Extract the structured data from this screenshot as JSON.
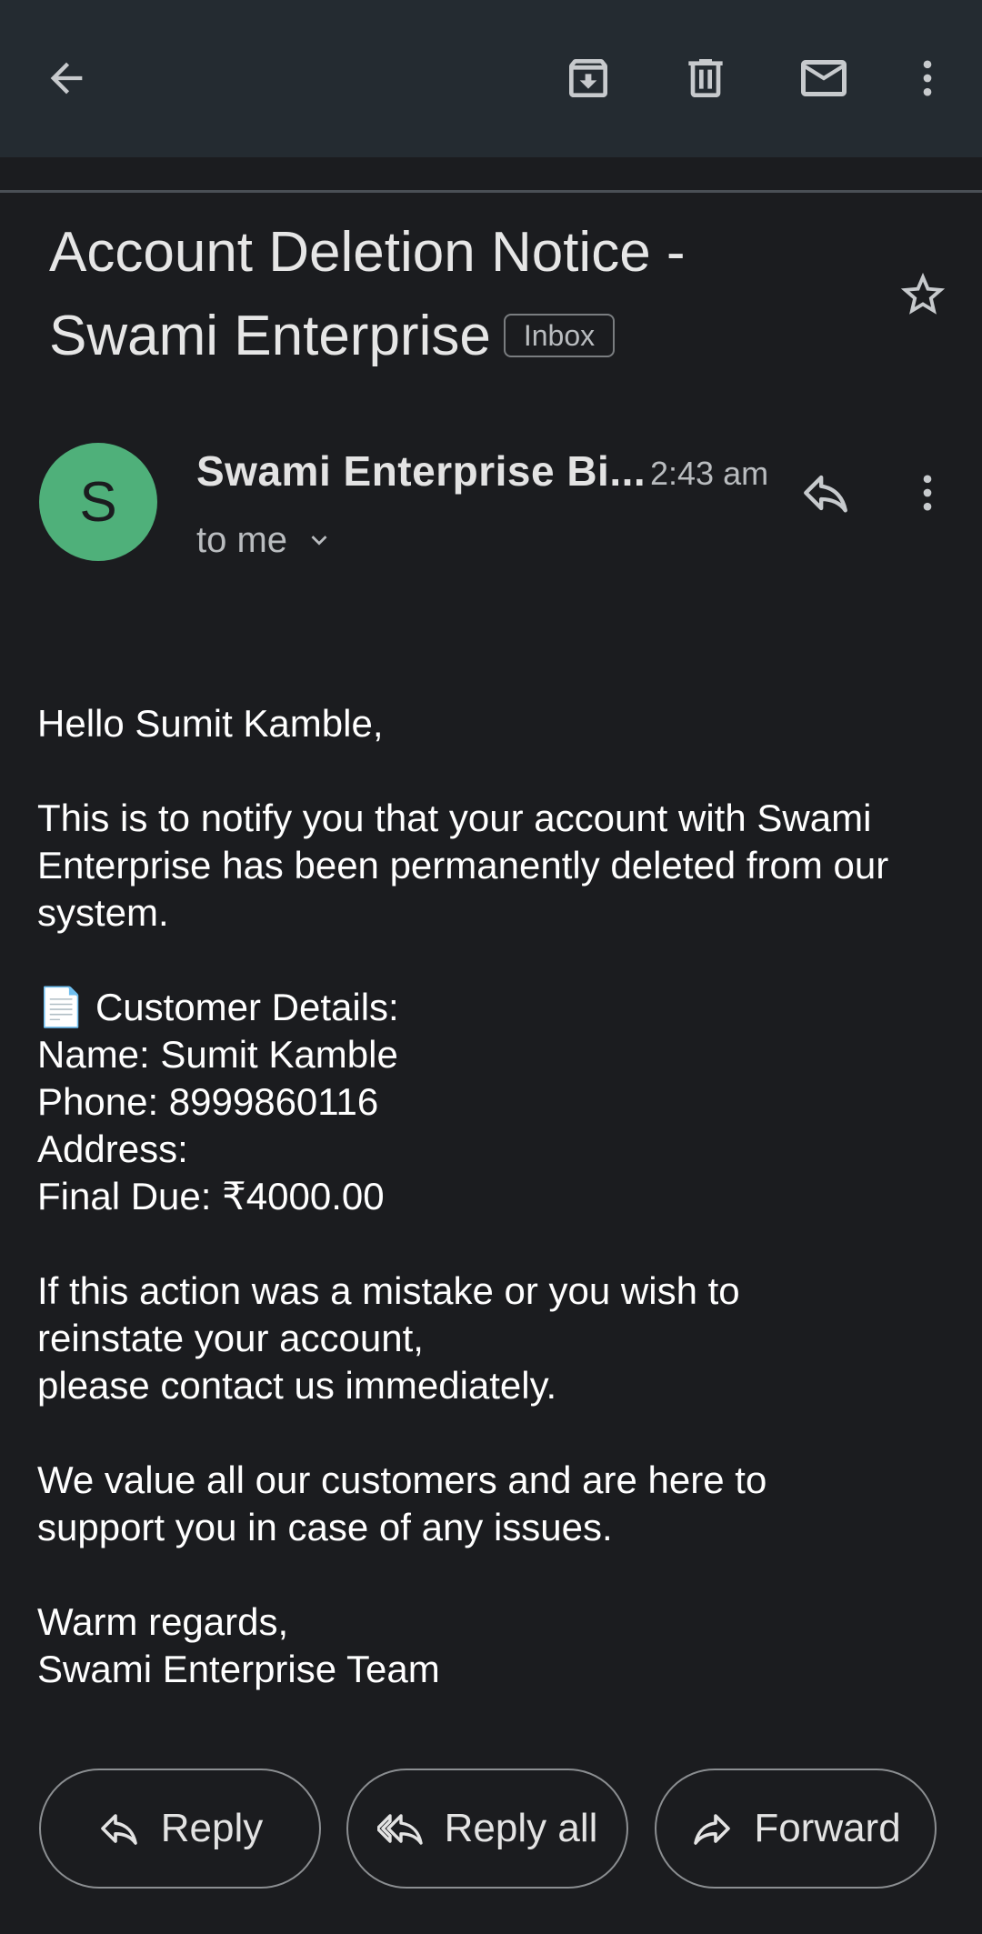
{
  "toolbar": {
    "back_icon": "arrow-back-icon",
    "archive_icon": "archive-icon",
    "delete_icon": "trash-icon",
    "mark_unread_icon": "mail-icon",
    "more_icon": "more-vert-icon"
  },
  "email": {
    "subject": "Account Deletion Notice - Swami Enterprise",
    "label": "Inbox",
    "sender_initial": "S",
    "sender_name": "Swami Enterprise Bi...",
    "time": "2:43 am",
    "recipient": "to me",
    "avatar_color": "#4fb07a",
    "body": {
      "greeting": "Hello Sumit Kamble,",
      "notice_line1": "This is to notify you that your account with Swami",
      "notice_line2": "Enterprise has been permanently deleted from our",
      "notice_line3": "system.",
      "details_heading": "📄 Customer Details:",
      "name": "Name: Sumit Kamble",
      "phone": "Phone: 8999860116",
      "address": "Address:",
      "final_due": "Final Due: ₹4000.00",
      "mistake_line1": "If this action was a mistake or you wish to",
      "mistake_line2": "reinstate your account,",
      "mistake_line3": "please contact us immediately.",
      "value_line1": "We value all our customers and are here to",
      "value_line2": "support you in case of any issues.",
      "regards": "Warm regards,",
      "team": "Swami Enterprise Team"
    }
  },
  "actions": {
    "reply": "Reply",
    "reply_all": "Reply all",
    "forward": "Forward"
  }
}
